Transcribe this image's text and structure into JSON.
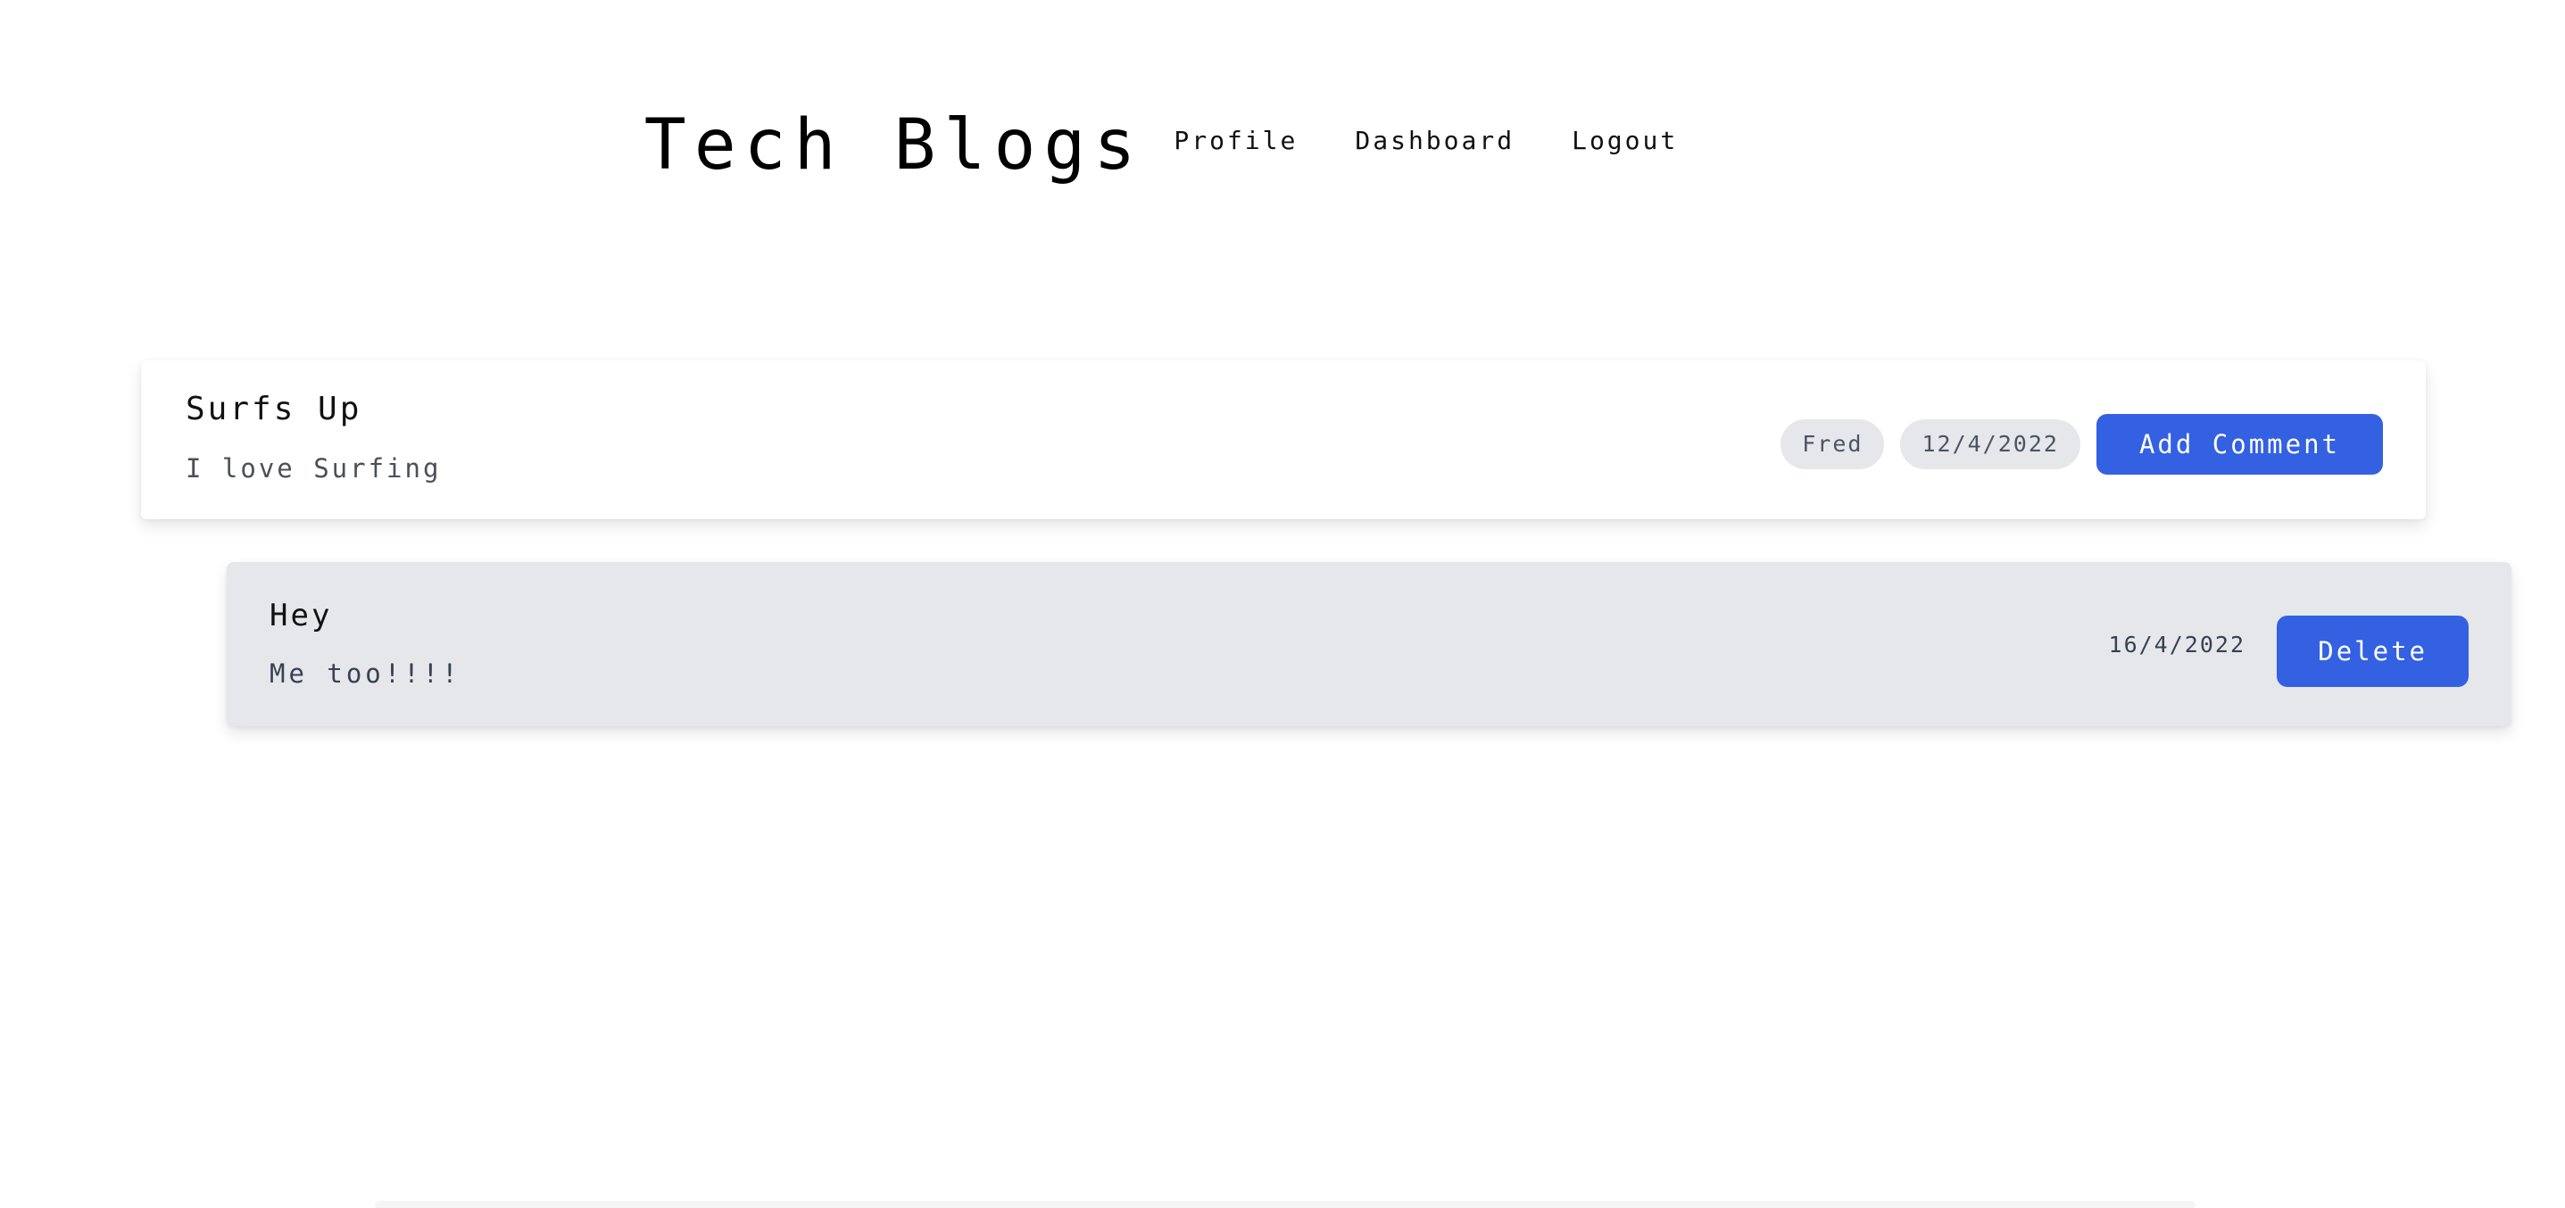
{
  "header": {
    "brand": "Tech Blogs",
    "nav": [
      "Profile",
      "Dashboard",
      "Logout"
    ]
  },
  "post": {
    "title": "Surfs Up",
    "body": "I love Surfing",
    "author": "Fred",
    "date": "12/4/2022",
    "action_label": "Add Comment"
  },
  "comment": {
    "title": "Hey",
    "body": "Me too!!!!",
    "date": "16/4/2022",
    "action_label": "Delete"
  },
  "colors": {
    "primary": "#3461e2",
    "pill_bg": "#e5e7eb",
    "comment_bg": "#e5e7eb"
  }
}
